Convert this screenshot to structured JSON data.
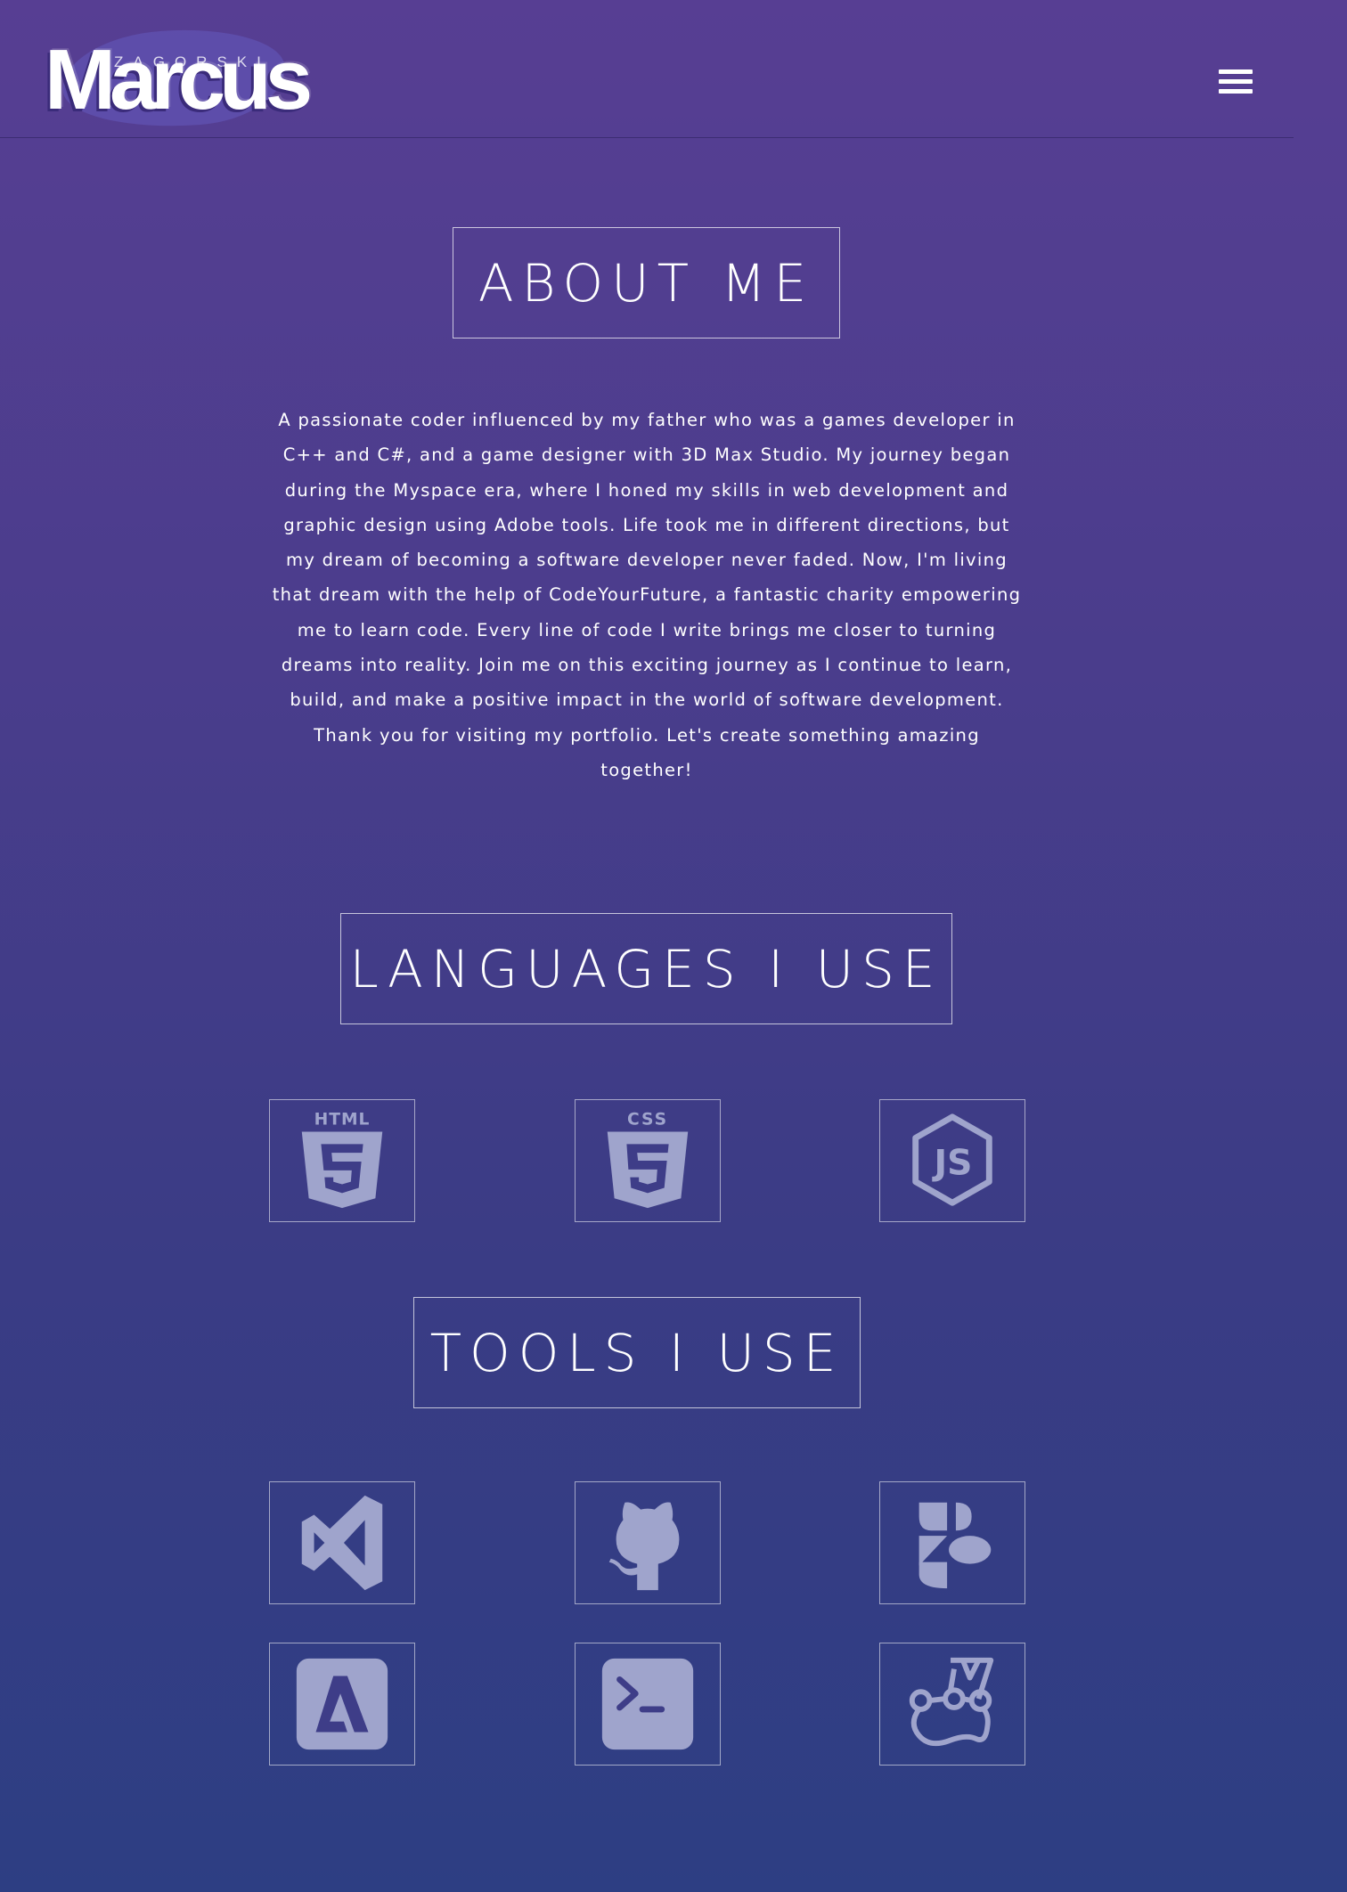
{
  "header": {
    "logo_small": "ZAGORSKI",
    "logo_big": "Marcus",
    "menu_icon": "hamburger-icon"
  },
  "about": {
    "title": "ABOUT ME",
    "paragraph": "A passionate coder influenced by my father who was a games developer in C++ and C#, and a game designer with 3D Max Studio. My journey began during the Myspace era, where I honed my skills in web development and graphic design using Adobe tools. Life took me in different directions, but my dream of becoming a software developer never faded. Now, I'm living that dream with the help of CodeYourFuture, a fantastic charity empowering me to learn code. Every line of code I write brings me closer to turning dreams into reality. Join me on this exciting journey as I continue to learn, build, and make a positive impact in the world of software development. Thank you for visiting my portfolio. Let's create something amazing together!"
  },
  "languages": {
    "title": "LANGUAGES I USE",
    "items": [
      {
        "icon": "html5-icon",
        "label": "HTML"
      },
      {
        "icon": "css3-icon",
        "label": "CSS"
      },
      {
        "icon": "nodejs-icon",
        "label": "JS"
      }
    ]
  },
  "tools": {
    "title": "TOOLS I USE",
    "items": [
      {
        "icon": "vscode-icon"
      },
      {
        "icon": "github-icon"
      },
      {
        "icon": "figma-icon"
      },
      {
        "icon": "adobe-icon"
      },
      {
        "icon": "terminal-icon"
      },
      {
        "icon": "jest-icon"
      }
    ]
  },
  "colors": {
    "background_top": "#573e93",
    "background_bottom": "#2d3e83",
    "icon": "#9fa4cc",
    "text": "#ffffff"
  }
}
